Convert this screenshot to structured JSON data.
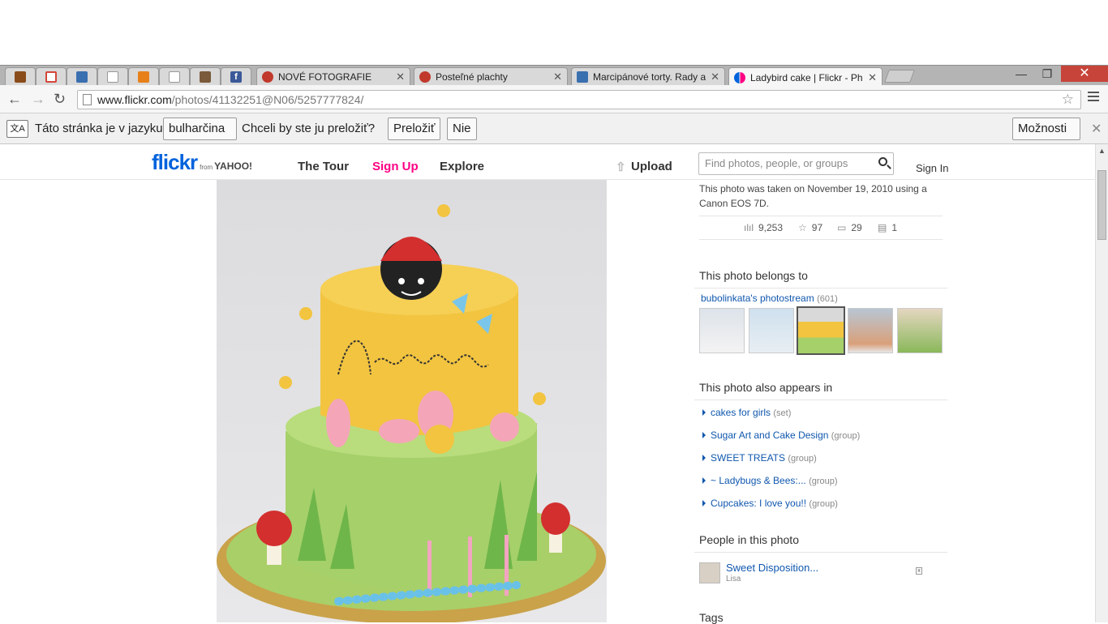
{
  "browser": {
    "tabs": [
      {
        "label": "",
        "icon": "orange-app-icon",
        "color": "#8a4b1a"
      },
      {
        "label": "",
        "icon": "gmail-icon",
        "color": "#d44638"
      },
      {
        "label": "",
        "icon": "rocking-horse-icon",
        "color": "#3a6fb0"
      },
      {
        "label": "",
        "icon": "blank-page-icon",
        "color": "#ffffff"
      },
      {
        "label": "",
        "icon": "shopping-bag-icon",
        "color": "#e8801a"
      },
      {
        "label": "",
        "icon": "blank-page-icon",
        "color": "#ffffff"
      },
      {
        "label": "",
        "icon": "basket-icon",
        "color": "#7a5a3a"
      },
      {
        "label": "",
        "icon": "facebook-icon",
        "color": "#3b5998"
      },
      {
        "label": "NOVÉ FOTOGRAFIE",
        "icon": "cake-icon",
        "color": "#c0392b"
      },
      {
        "label": "Posteľné plachty",
        "icon": "cake-icon",
        "color": "#c0392b"
      },
      {
        "label": "Marcipánové torty. Rady a",
        "icon": "rocking-horse-icon",
        "color": "#3a6fb0"
      },
      {
        "label": "Ladybird cake | Flickr - Ph",
        "icon": "flickr-icon",
        "color": "#0063dc",
        "active": true
      }
    ],
    "window_controls": {
      "minimize": "—",
      "maximize": "❐",
      "close": "✕"
    },
    "url_host": "www.flickr.com",
    "url_path": "/photos/41132251@N06/5257777824/",
    "translate_bar": {
      "text_before": "Táto stránka je v jazyku",
      "language": "bulharčina",
      "question": "Chceli by ste ju preložiť?",
      "translate_button": "Preložiť",
      "no_button": "Nie",
      "options_button": "Možnosti"
    }
  },
  "flickr": {
    "logo_text": "flickr",
    "logo_from": "from",
    "logo_yahoo": "YAHOO!",
    "nav": {
      "tour": "The Tour",
      "signup": "Sign Up",
      "explore": "Explore",
      "upload": "Upload"
    },
    "search_placeholder": "Find photos, people, or groups",
    "signin": "Sign In",
    "colors": {
      "flickr_blue": "#0063dc",
      "flickr_pink": "#ff0084",
      "link": "#1057ae"
    }
  },
  "photo_info": {
    "taken": "This photo was taken on November 19, 2010 using a Canon EOS 7D.",
    "views": "9,253",
    "faves": "97",
    "comments": "29",
    "notes": "1"
  },
  "belongs": {
    "heading": "This photo belongs to",
    "stream": "bubolinkata's photostream",
    "count": "(601)"
  },
  "appears": {
    "heading": "This photo also appears in",
    "items": [
      {
        "name": "cakes for girls",
        "kind": "(set)"
      },
      {
        "name": "Sugar Art and Cake Design",
        "kind": "(group)"
      },
      {
        "name": "SWEET TREATS",
        "kind": "(group)"
      },
      {
        "name": "~ Ladybugs & Bees:...",
        "kind": "(group)"
      },
      {
        "name": "Cupcakes: I love you!!",
        "kind": "(group)"
      }
    ]
  },
  "people": {
    "heading": "People in this photo",
    "name": "Sweet Disposition...",
    "sub": "Lisa"
  },
  "tags": {
    "heading": "Tags"
  }
}
